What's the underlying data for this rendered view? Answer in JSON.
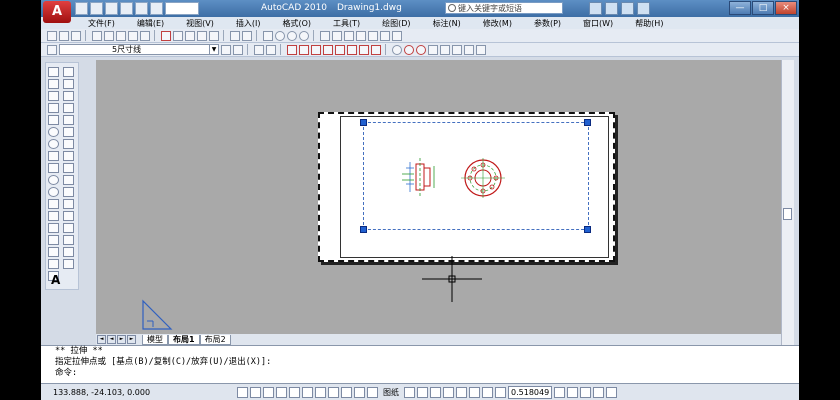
{
  "app": {
    "logo_letter": "A",
    "title": "AutoCAD 2010",
    "document": "Drawing1.dwg",
    "search_placeholder": "键入关键字或短语",
    "window_buttons": [
      "—",
      "□",
      "×"
    ]
  },
  "menu": [
    "文件(F)",
    "编辑(E)",
    "视图(V)",
    "插入(I)",
    "格式(O)",
    "工具(T)",
    "绘图(D)",
    "标注(N)",
    "修改(M)",
    "参数(P)",
    "窗口(W)",
    "帮助(H)"
  ],
  "layer_toolbar": {
    "current_layer": "5尺寸线"
  },
  "layout_tabs": {
    "tabs": [
      "模型",
      "布局1",
      "布局2"
    ],
    "active": "布局1"
  },
  "command": {
    "line1": "** 拉伸 **",
    "line2": "指定拉伸点或 [基点(B)/复制(C)/放弃(U)/退出(X)]:",
    "line3": "命令:"
  },
  "status": {
    "coordinates": "133.888,  -24.103,  0.000",
    "paper_label": "图纸",
    "annotation_scale": "0.518049",
    "small_label": "A"
  },
  "colors": {
    "titlebar": "#4a7db5",
    "workspace": "#a9a9a9",
    "grip": "#2060d0",
    "viewport_border": "#4470c0",
    "drawing_red": "#c01818"
  }
}
